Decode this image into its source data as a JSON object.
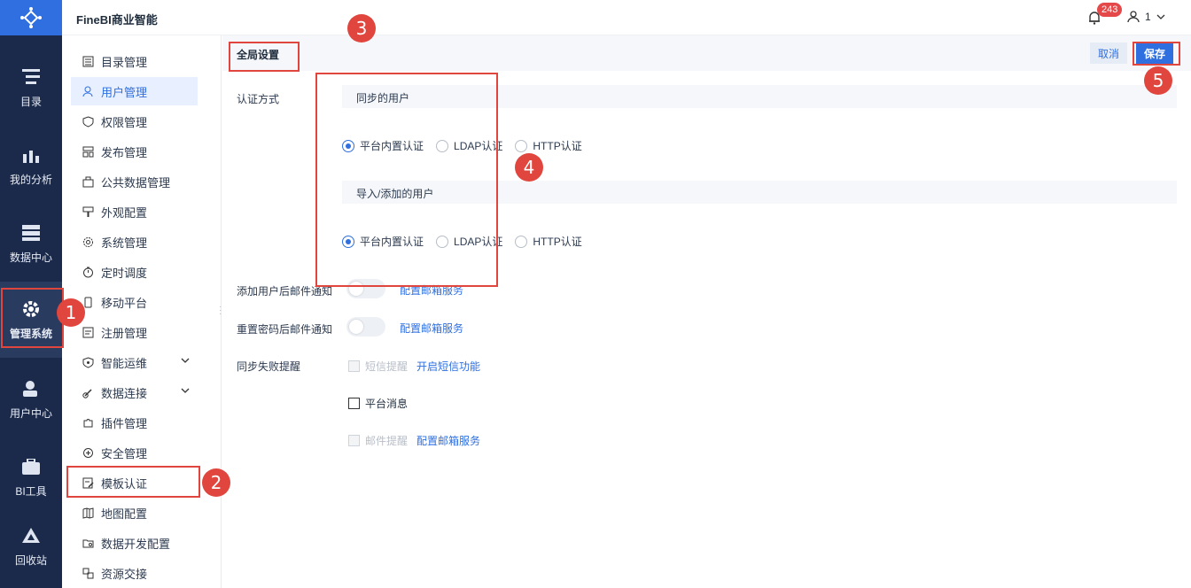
{
  "app": {
    "title": "FineBI商业智能"
  },
  "header": {
    "notification_count": "243",
    "user_name": "1"
  },
  "rail": [
    {
      "label": "目录"
    },
    {
      "label": "我的分析"
    },
    {
      "label": "数据中心"
    },
    {
      "label": "管理系统"
    },
    {
      "label": "用户中心"
    },
    {
      "label": "BI工具"
    },
    {
      "label": "回收站"
    }
  ],
  "submenu": [
    {
      "label": "目录管理"
    },
    {
      "label": "用户管理"
    },
    {
      "label": "权限管理"
    },
    {
      "label": "发布管理"
    },
    {
      "label": "公共数据管理"
    },
    {
      "label": "外观配置"
    },
    {
      "label": "系统管理"
    },
    {
      "label": "定时调度"
    },
    {
      "label": "移动平台"
    },
    {
      "label": "注册管理"
    },
    {
      "label": "智能运维"
    },
    {
      "label": "数据连接"
    },
    {
      "label": "插件管理"
    },
    {
      "label": "安全管理"
    },
    {
      "label": "模板认证"
    },
    {
      "label": "地图配置"
    },
    {
      "label": "数据开发配置"
    },
    {
      "label": "资源交接"
    }
  ],
  "content": {
    "tab_title": "全局设置",
    "cancel_label": "取消",
    "save_label": "保存",
    "auth_label": "认证方式",
    "sync_users_title": "同步的用户",
    "import_users_title": "导入/添加的用户",
    "radio_options": [
      "平台内置认证",
      "LDAP认证",
      "HTTP认证"
    ],
    "add_user_notify_label": "添加用户后邮件通知",
    "reset_pwd_notify_label": "重置密码后邮件通知",
    "config_mail_link": "配置邮箱服务",
    "sync_fail_label": "同步失败提醒",
    "sms_label": "短信提醒",
    "open_sms_link": "开启短信功能",
    "platform_msg_label": "平台消息",
    "mail_label": "邮件提醒"
  },
  "annotations": [
    "1",
    "2",
    "3",
    "4",
    "5"
  ]
}
